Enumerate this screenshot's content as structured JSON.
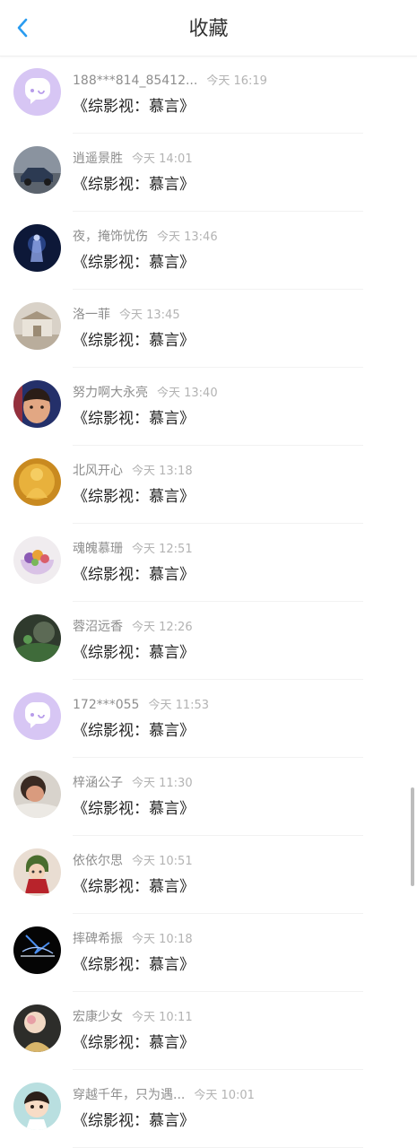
{
  "header": {
    "title": "收藏",
    "back_icon": "chevron-left-icon",
    "accent_color": "#2a9cf0"
  },
  "items": [
    {
      "name": "188***814_85412...",
      "time": "今天 16:19",
      "book": "《综影视：慕言》",
      "avatar": "default-chat-avatar"
    },
    {
      "name": "逍遥景胜",
      "time": "今天 14:01",
      "book": "《综影视：慕言》",
      "avatar": "car-photo-avatar"
    },
    {
      "name": "夜，掩饰忧伤",
      "time": "今天 13:46",
      "book": "《综影视：慕言》",
      "avatar": "night-figure-avatar"
    },
    {
      "name": "洛一菲",
      "time": "今天 13:45",
      "book": "《综影视：慕言》",
      "avatar": "palace-avatar"
    },
    {
      "name": "努力啊大永亮",
      "time": "今天 13:40",
      "book": "《综影视：慕言》",
      "avatar": "child-face-avatar"
    },
    {
      "name": "北风开心",
      "time": "今天 13:18",
      "book": "《综影视：慕言》",
      "avatar": "golden-buddha-avatar"
    },
    {
      "name": "魂魄慕珊",
      "time": "今天 12:51",
      "book": "《综影视：慕言》",
      "avatar": "fruit-bowl-avatar"
    },
    {
      "name": "蓉沼远香",
      "time": "今天 12:26",
      "book": "《综影视：慕言》",
      "avatar": "dark-nature-avatar"
    },
    {
      "name": "172***055",
      "time": "今天 11:53",
      "book": "《综影视：慕言》",
      "avatar": "default-chat-avatar"
    },
    {
      "name": "梓涵公子",
      "time": "今天 11:30",
      "book": "《综影视：慕言》",
      "avatar": "person-lying-avatar"
    },
    {
      "name": "依依尔思",
      "time": "今天 10:51",
      "book": "《综影视：慕言》",
      "avatar": "anime-girl-red-avatar"
    },
    {
      "name": "摔碑希振",
      "time": "今天 10:18",
      "book": "《综影视：慕言》",
      "avatar": "dark-glow-avatar"
    },
    {
      "name": "宏康少女",
      "time": "今天 10:11",
      "book": "《综影视：慕言》",
      "avatar": "rose-avatar"
    },
    {
      "name": "穿越千年，只为遇...",
      "time": "今天 10:01",
      "book": "《综影视：慕言》",
      "avatar": "cartoon-boy-avatar"
    }
  ]
}
